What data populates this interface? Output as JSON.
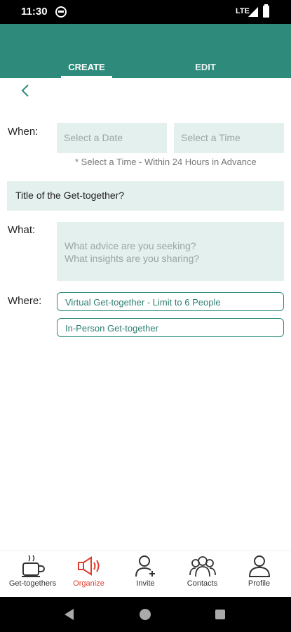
{
  "status_bar": {
    "time": "11:30",
    "network": "LTE"
  },
  "header": {
    "tabs": [
      {
        "label": "CREATE",
        "active": true
      },
      {
        "label": "EDIT",
        "active": false
      }
    ]
  },
  "form": {
    "when_label": "When:",
    "date_placeholder": "Select a Date",
    "time_placeholder": "Select a Time",
    "time_hint": "* Select a Time - Within 24 Hours in Advance",
    "title_value": "Title of the Get-together?",
    "what_label": "What:",
    "what_placeholder_line1": "What advice are you seeking?",
    "what_placeholder_line2": "What insights are you sharing?",
    "where_label": "Where:",
    "where_options": [
      "Virtual Get-together - Limit to 6 People",
      "In-Person Get-together"
    ]
  },
  "bottom_nav": {
    "items": [
      {
        "label": "Get-togethers",
        "icon": "coffee-cup-icon",
        "active": false
      },
      {
        "label": "Organize",
        "icon": "megaphone-icon",
        "active": true
      },
      {
        "label": "Invite",
        "icon": "add-person-icon",
        "active": false
      },
      {
        "label": "Contacts",
        "icon": "group-icon",
        "active": false
      },
      {
        "label": "Profile",
        "icon": "person-icon",
        "active": false
      }
    ]
  },
  "colors": {
    "brand": "#2e8b7c",
    "field_bg": "#e4f0ed",
    "active_nav": "#e03c2e"
  }
}
